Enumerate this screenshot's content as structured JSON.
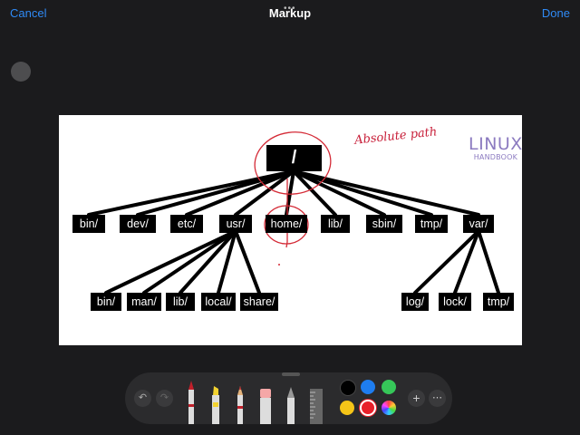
{
  "header": {
    "cancel_label": "Cancel",
    "title": "Markup",
    "done_label": "Done",
    "grabber": "•••"
  },
  "diagram": {
    "root": "/",
    "annotation": "Absolute path",
    "logo": {
      "line1": "LINUX",
      "line2": "HANDBOOK"
    },
    "level1": [
      "bin/",
      "dev/",
      "etc/",
      "usr/",
      "home/",
      "lib/",
      "sbin/",
      "tmp/",
      "var/"
    ],
    "usr_children": [
      "bin/",
      "man/",
      "lib/",
      "local/",
      "share/"
    ],
    "var_children": [
      "log/",
      "lock/",
      "tmp/"
    ]
  },
  "toolbar": {
    "undo": "↶",
    "redo": "↷",
    "tools": [
      "pen",
      "highlighter",
      "pencil",
      "eraser",
      "lasso",
      "ruler"
    ],
    "colors": {
      "black": "#000000",
      "blue": "#1e7df0",
      "green": "#36c759",
      "yellow": "#f5c518",
      "red": "#e8202a"
    },
    "selected_color": "red",
    "add": "+",
    "more": "⋯"
  }
}
